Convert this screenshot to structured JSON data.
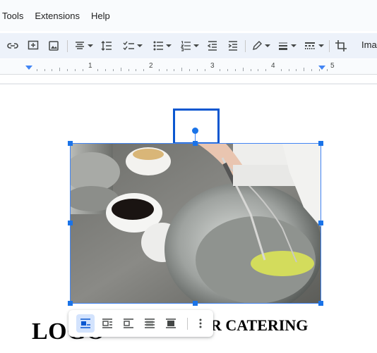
{
  "menu": [
    "Tools",
    "Extensions",
    "Help"
  ],
  "toolbar": {
    "buttons": [
      "link-icon",
      "add-comment-icon",
      "insert-image-icon",
      "align-icon",
      "line-spacing-icon",
      "checklist-icon",
      "bulleted-list-icon",
      "numbered-list-icon",
      "decrease-indent-icon",
      "increase-indent-icon",
      "border-color-icon",
      "border-weight-icon",
      "border-dash-icon",
      "crop-icon"
    ],
    "image_options_label": "Ima"
  },
  "ruler": {
    "labels": [
      "1",
      "2",
      "3",
      "4",
      "5"
    ]
  },
  "image_toolbar": {
    "buttons": [
      "wrap-inline-icon",
      "wrap-text-icon",
      "break-text-icon",
      "behind-text-icon",
      "in-front-of-text-icon",
      "more-options-icon"
    ],
    "active": "wrap-inline-icon"
  },
  "document": {
    "logo": "LOGO",
    "heading": "R CATERING"
  },
  "colors": {
    "selection": "#1a73e8",
    "rotate_box": "#0b57d0",
    "toolbar_bg": "#edf2fa",
    "chrome_bg": "#f9fbfd"
  }
}
